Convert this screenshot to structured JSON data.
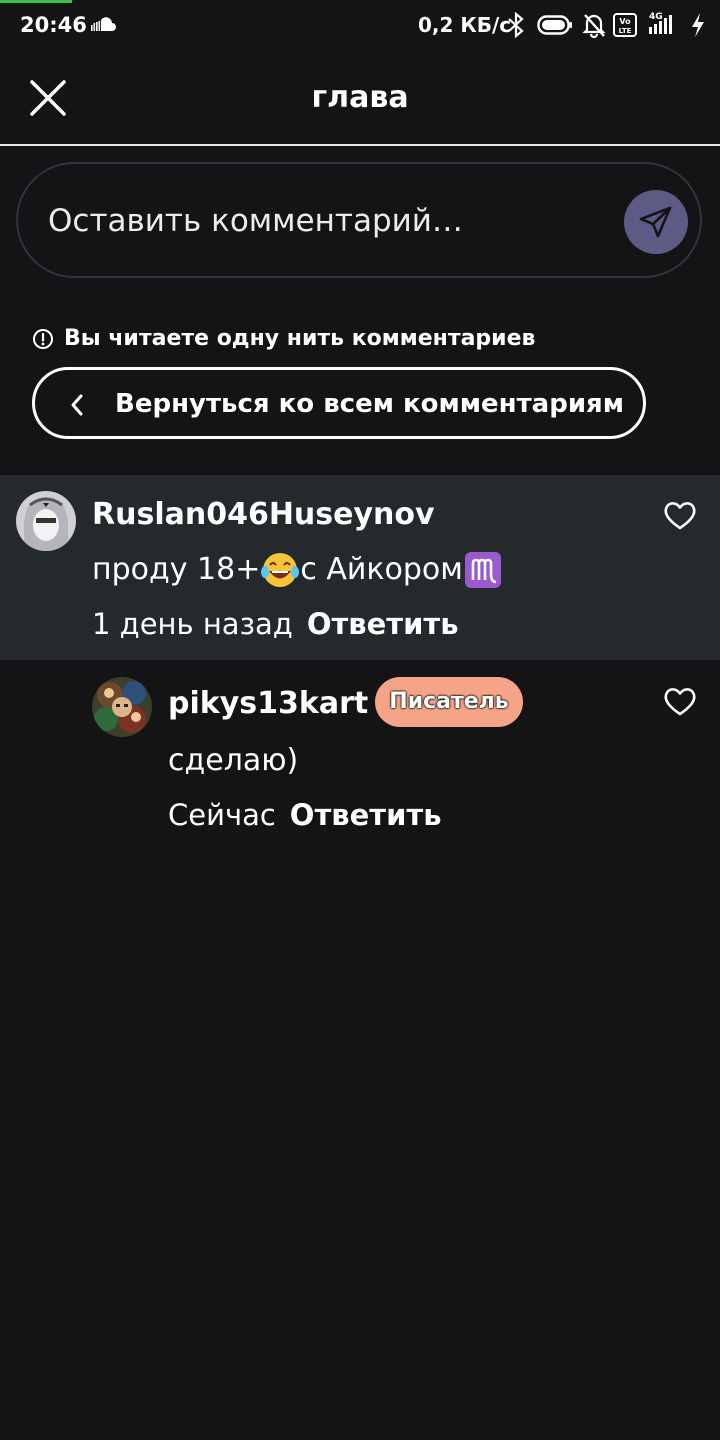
{
  "status_bar": {
    "time": "20:46",
    "net_speed": "0,2 КБ/с",
    "network": "4G",
    "icons": [
      "soundcloud-icon",
      "bluetooth-icon",
      "battery-icon",
      "mute-icon",
      "volte-icon",
      "signal-icon",
      "charging-icon"
    ]
  },
  "header": {
    "title": "глава",
    "close_icon": "close-icon"
  },
  "comment_input": {
    "placeholder": "Оставить комментарий…",
    "value": "",
    "send_icon": "send-icon"
  },
  "thread": {
    "notice": "Вы читаете одну нить комментариев",
    "back_label": "Вернуться ко всем комментариям"
  },
  "comments": [
    {
      "username": "Ruslan046Huseynov",
      "text_before": "проду 18+",
      "text_middle": " с Айкором",
      "emojis": [
        "laughing-tears-emoji",
        "virgo-emoji"
      ],
      "time": "1 день назад",
      "reply_label": "Ответить",
      "highlighted": true
    },
    {
      "username": "pikys13kart",
      "badge": "Писатель",
      "text": "сделаю)",
      "time": "Сейчас",
      "reply_label": "Ответить",
      "highlighted": false
    }
  ],
  "colors": {
    "background": "#141316",
    "highlight_row": "#24292c",
    "send_button": "#5d5a85",
    "badge": "#f6a487",
    "progress": "#3fbf4a"
  }
}
